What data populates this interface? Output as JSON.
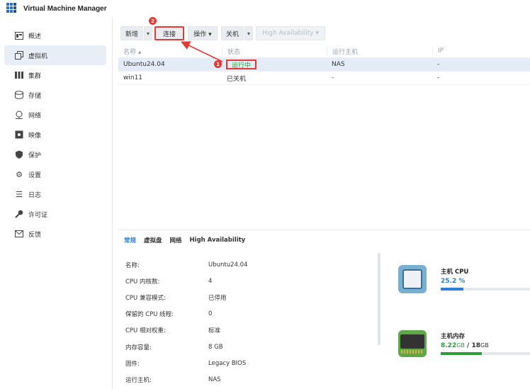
{
  "app": {
    "title": "Virtual Machine Manager"
  },
  "sidebar": {
    "items": [
      {
        "label": "概述",
        "icon": "overview-icon"
      },
      {
        "label": "虚拟机",
        "icon": "virtual-machine-icon",
        "active": true
      },
      {
        "label": "集群",
        "icon": "cluster-icon"
      },
      {
        "label": "存储",
        "icon": "storage-icon"
      },
      {
        "label": "网络",
        "icon": "network-icon"
      },
      {
        "label": "映像",
        "icon": "image-icon"
      },
      {
        "label": "保护",
        "icon": "shield-icon"
      },
      {
        "label": "设置",
        "icon": "gear-icon"
      },
      {
        "label": "日志",
        "icon": "log-list-icon"
      },
      {
        "label": "许可证",
        "icon": "key-icon"
      },
      {
        "label": "反馈",
        "icon": "mail-icon"
      }
    ]
  },
  "toolbar": {
    "new_label": "新增",
    "connect_label": "连接",
    "action_label": "操作 ▾",
    "shutdown_label": "关机",
    "ha_label": "High Availability ▾"
  },
  "grid": {
    "headers": [
      "名称 ▴",
      "状态",
      "运行主机",
      "IP"
    ],
    "rows": [
      {
        "name": "Ubuntu24.04",
        "status": "运行中",
        "host": "NAS",
        "ip": "-",
        "selected": true
      },
      {
        "name": "win11",
        "status": "已关机",
        "host": "-",
        "ip": "-",
        "selected": false
      }
    ]
  },
  "annotations": {
    "badge1": "1",
    "badge2": "2"
  },
  "detail": {
    "tabs": [
      "常规",
      "虚拟盘",
      "网络",
      "High Availability"
    ],
    "props": [
      {
        "key": "名称:",
        "value": "Ubuntu24.04"
      },
      {
        "key": "CPU 内核数:",
        "value": "4"
      },
      {
        "key": "CPU 兼容模式:",
        "value": "已停用"
      },
      {
        "key": "保留的 CPU 线程:",
        "value": "0"
      },
      {
        "key": "CPU 相对权重:",
        "value": "标准"
      },
      {
        "key": "内存容量:",
        "value": "8 GB"
      },
      {
        "key": "固件:",
        "value": "Legacy BIOS"
      },
      {
        "key": "运行主机:",
        "value": "NAS"
      }
    ]
  },
  "resources": {
    "cpu": {
      "title": "主机 CPU",
      "value": "25.2 %",
      "fraction": 0.252,
      "color": "#2b80d6"
    },
    "memory": {
      "title": "主机内存",
      "used": "8.22",
      "used_unit": "GB",
      "sep": " / ",
      "total": "18",
      "total_unit": "GB",
      "fraction": 0.457,
      "color": "#2e9e3c"
    }
  },
  "colors": {
    "accent": "#2b80d6",
    "highlight": "#e53935",
    "running": "#2e9e3c"
  }
}
